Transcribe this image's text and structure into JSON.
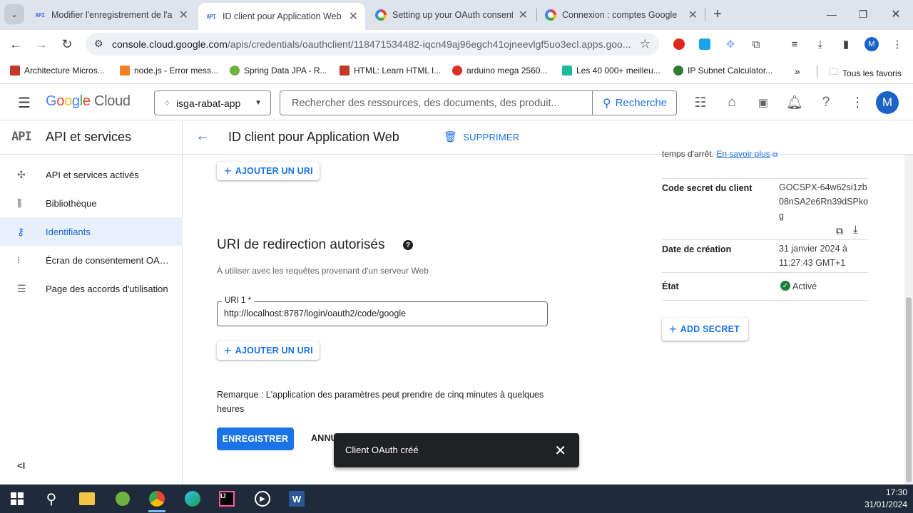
{
  "browser": {
    "tabs": [
      {
        "label": "Modifier l'enregistrement de l'a",
        "icon": "api-icon",
        "active": false
      },
      {
        "label": "ID client pour Application Web",
        "icon": "api-icon",
        "active": true
      },
      {
        "label": "Setting up your OAuth consent",
        "icon": "google-icon",
        "active": false
      },
      {
        "label": "Connexion : comptes Google",
        "icon": "google-icon",
        "active": false
      }
    ],
    "url_host": "console.cloud.google.com",
    "url_path": "/apis/credentials/oauthclient/118471534482-iqcn49aj96egch41ojneevlgf5uo3ecl.apps.goo...",
    "profile_initial": "M",
    "bookmarks": [
      {
        "label": "Architecture Micros...",
        "color": "#c0392b"
      },
      {
        "label": "node.js - Error mess...",
        "color": "#f48024"
      },
      {
        "label": "Spring Data JPA - R...",
        "color": "#6db33f"
      },
      {
        "label": "HTML: Learn HTML I...",
        "color": "#c0392b"
      },
      {
        "label": "arduino mega 2560...",
        "color": "#d93025"
      },
      {
        "label": "Les 40 000+ meilleu...",
        "color": "#1abc9c"
      },
      {
        "label": "IP Subnet Calculator...",
        "color": "#2e7d32"
      }
    ],
    "all_bookmarks": "Tous les favoris"
  },
  "gcp": {
    "logo": {
      "google": "Google",
      "cloud": "Cloud"
    },
    "project": "isga-rabat-app",
    "search_placeholder": "Rechercher des ressources, des documents, des produit...",
    "search_button": "Recherche",
    "avatar_initial": "M"
  },
  "sidebar": {
    "badge": "API",
    "title": "API et services",
    "items": [
      {
        "label": "API et services activés",
        "icon": "api-services-icon",
        "active": false
      },
      {
        "label": "Bibliothèque",
        "icon": "library-icon",
        "active": false
      },
      {
        "label": "Identifiants",
        "icon": "key-icon",
        "active": true
      },
      {
        "label": "Écran de consentement OAuth",
        "icon": "consent-icon",
        "active": false
      },
      {
        "label": "Page des accords d'utilisation",
        "icon": "agreements-icon",
        "active": false
      }
    ],
    "collapse": "<I"
  },
  "page": {
    "title": "ID client pour Application Web",
    "delete_label": "SUPPRIMER",
    "add_uri_label": "AJOUTER UN URI",
    "redirect_section_title": "URI de redirection autorisés",
    "redirect_section_help": "À utiliser avec les requêtes provenant d'un serveur Web",
    "uri_field_label": "URI 1 *",
    "uri_field_value": "http://localhost:8787/login/oauth2/code/google",
    "note": "Remarque : L'application des paramètres peut prendre de cinq minutes à quelques heures",
    "save_label": "ENREGISTRER",
    "cancel_label": "ANNU"
  },
  "right_panel": {
    "top_cut_text": "temps d'arrêt.",
    "top_cut_link": "En savoir plus",
    "secret_label": "Code secret du client",
    "secret_value": "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",
    "created_label": "Date de création",
    "created_value": "31 janvier 2024 à 11:27:43 GMT+1",
    "state_label": "État",
    "state_value": "Activé",
    "add_secret_label": "ADD SECRET"
  },
  "snackbar": {
    "message": "Client OAuth créé"
  },
  "taskbar": {
    "time": "17:30",
    "date": "31/01/2024"
  },
  "colors": {
    "accent": "#1a73e8",
    "active_bg": "#e8f0fe",
    "success": "#188038"
  }
}
